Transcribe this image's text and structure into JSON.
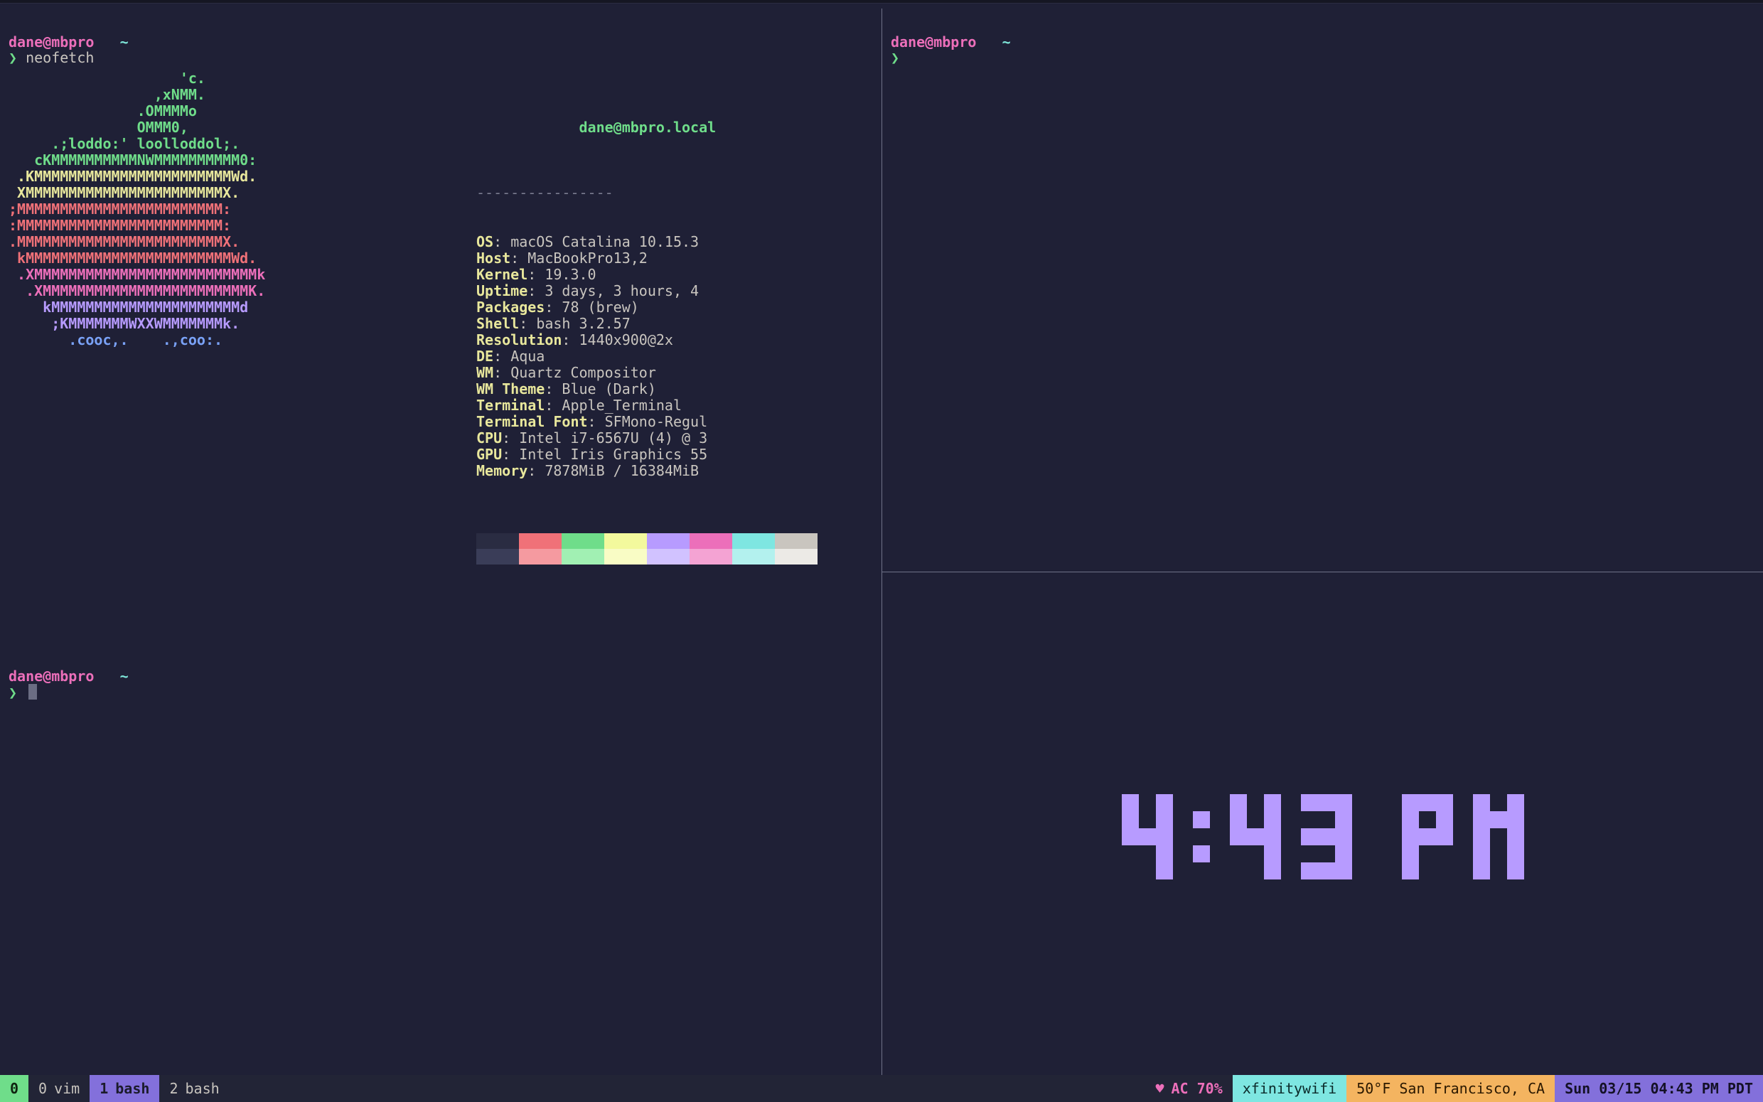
{
  "prompt": {
    "user": "dane",
    "at": "@",
    "host": "mbpro",
    "path": "~",
    "chevron": "❯"
  },
  "pane_left": {
    "command": "neofetch"
  },
  "neofetch": {
    "title_user": "dane",
    "title_at": "@",
    "title_host": "mbpro.local",
    "dashes": "----------------",
    "logo_lines": [
      {
        "color": "green",
        "text": "                    'c."
      },
      {
        "color": "green",
        "text": "                 ,xNMM."
      },
      {
        "color": "green",
        "text": "               .OMMMMo"
      },
      {
        "color": "green",
        "text": "               OMMM0,"
      },
      {
        "color": "green",
        "text": "     .;loddo:' loolloddol;."
      },
      {
        "color": "green",
        "text": "   cKMMMMMMMMMMNWMMMMMMMMMM0:"
      },
      {
        "color": "yellow",
        "text": " .KMMMMMMMMMMMMMMMMMMMMMMMWd."
      },
      {
        "color": "yellow",
        "text": " XMMMMMMMMMMMMMMMMMMMMMMMX."
      },
      {
        "color": "red",
        "text": ";MMMMMMMMMMMMMMMMMMMMMMMM:"
      },
      {
        "color": "red",
        "text": ":MMMMMMMMMMMMMMMMMMMMMMMM:"
      },
      {
        "color": "red",
        "text": ".MMMMMMMMMMMMMMMMMMMMMMMMX."
      },
      {
        "color": "red",
        "text": " kMMMMMMMMMMMMMMMMMMMMMMMMWd."
      },
      {
        "color": "pink",
        "text": " .XMMMMMMMMMMMMMMMMMMMMMMMMMMk"
      },
      {
        "color": "pink",
        "text": "  .XMMMMMMMMMMMMMMMMMMMMMMMMK."
      },
      {
        "color": "purple",
        "text": "    kMMMMMMMMMMMMMMMMMMMMMMd"
      },
      {
        "color": "purple",
        "text": "     ;KMMMMMMMWXXWMMMMMMMk."
      },
      {
        "color": "blue",
        "text": "       .cooc,.    .,coo:."
      }
    ],
    "entries": [
      {
        "key": "OS",
        "value": "macOS Catalina 10.15.3"
      },
      {
        "key": "Host",
        "value": "MacBookPro13,2"
      },
      {
        "key": "Kernel",
        "value": "19.3.0"
      },
      {
        "key": "Uptime",
        "value": "3 days, 3 hours, 4"
      },
      {
        "key": "Packages",
        "value": "78 (brew)"
      },
      {
        "key": "Shell",
        "value": "bash 3.2.57"
      },
      {
        "key": "Resolution",
        "value": "1440x900@2x"
      },
      {
        "key": "DE",
        "value": "Aqua"
      },
      {
        "key": "WM",
        "value": "Quartz Compositor"
      },
      {
        "key": "WM Theme",
        "value": "Blue (Dark)"
      },
      {
        "key": "Terminal",
        "value": "Apple_Terminal"
      },
      {
        "key": "Terminal Font",
        "value": "SFMono-Regul"
      },
      {
        "key": "CPU",
        "value": "Intel i7-6567U (4) @ 3"
      },
      {
        "key": "GPU",
        "value": "Intel Iris Graphics 55"
      },
      {
        "key": "Memory",
        "value": "7878MiB / 16384MiB"
      }
    ],
    "palette_indices": [
      0,
      1,
      2,
      3,
      4,
      5,
      6,
      7
    ]
  },
  "clock": {
    "text": "4:43 PM",
    "hours": "4",
    "minutes": "43",
    "ampm": "PM"
  },
  "status_bar": {
    "session_index": "0",
    "windows": [
      {
        "index": "0",
        "name": "vim",
        "active": false
      },
      {
        "index": "1",
        "name": "bash",
        "active": true
      },
      {
        "index": "2",
        "name": "bash",
        "active": false
      }
    ],
    "battery_heart": "♥",
    "battery": "AC 70%",
    "wifi": "xfinitywifi",
    "weather": "50°F San Francisco, CA",
    "datetime": "Sun 03/15 04:43 PM PDT"
  }
}
